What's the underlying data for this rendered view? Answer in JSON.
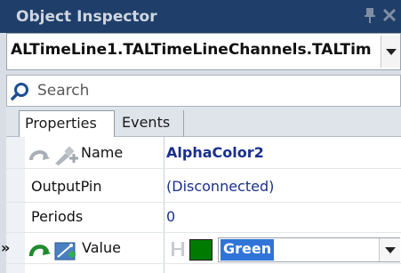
{
  "window": {
    "title": "Object Inspector",
    "pin_icon": "pin-icon",
    "close_icon": "close-icon"
  },
  "object_selector": {
    "value": "ALTimeLine1.TALTimeLineChannels.TALTim",
    "dropdown_icon": "chevron-down-icon"
  },
  "search": {
    "placeholder": "Search",
    "value": "",
    "icon": "search-icon"
  },
  "tabs": [
    {
      "label": "Properties",
      "active": true
    },
    {
      "label": "Events",
      "active": false
    }
  ],
  "properties": [
    {
      "name": "Name",
      "value": "AlphaColor2",
      "value_bold": true
    },
    {
      "name": "OutputPin",
      "value": "(Disconnected)"
    },
    {
      "name": "Periods",
      "value": "0"
    },
    {
      "name": "Value",
      "value": "Green",
      "selected": true,
      "marker": "»",
      "swatch_color": "#007a00"
    }
  ],
  "colors": {
    "titlebar": "#1f3f6a",
    "value_text": "#1a2f8c",
    "selection": "#3174d8"
  }
}
